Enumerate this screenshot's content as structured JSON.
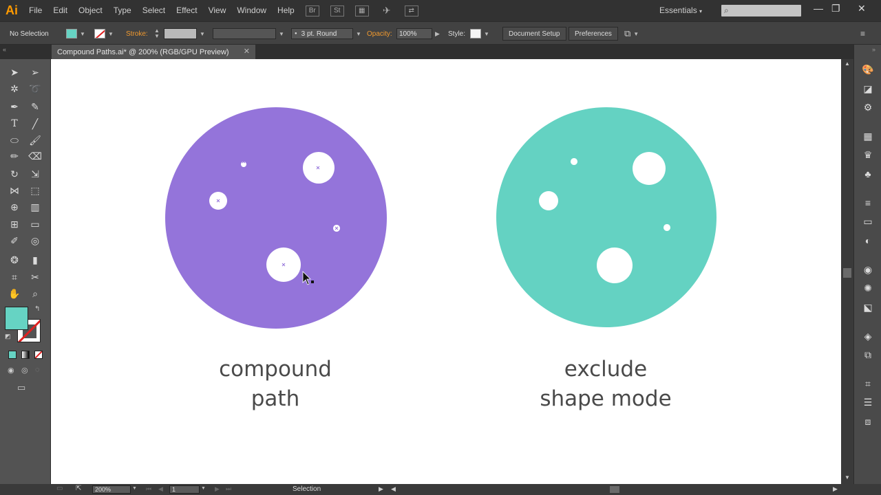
{
  "app": {
    "logo": "Ai"
  },
  "menu": [
    "File",
    "Edit",
    "Object",
    "Type",
    "Select",
    "Effect",
    "View",
    "Window",
    "Help"
  ],
  "menubar_icons": {
    "bridge": "Br",
    "stock": "St"
  },
  "workspace": "Essentials",
  "control": {
    "selection": "No Selection",
    "fill_color": "#66d3c3",
    "stroke_label": "Stroke:",
    "brush": "3 pt. Round",
    "opacity_label": "Opacity:",
    "opacity_value": "100%",
    "style_label": "Style:",
    "doc_setup": "Document Setup",
    "preferences": "Preferences"
  },
  "document": {
    "tab": "Compound Paths.ai* @ 200% (RGB/GPU Preview)"
  },
  "artwork": {
    "left": {
      "color": "#9474da",
      "caption_line1": "compound",
      "caption_line2": "path"
    },
    "right": {
      "color": "#64d2c2",
      "caption_line1": "exclude",
      "caption_line2": "shape mode"
    }
  },
  "status": {
    "zoom": "200%",
    "artboard": "1",
    "tool": "Selection"
  }
}
